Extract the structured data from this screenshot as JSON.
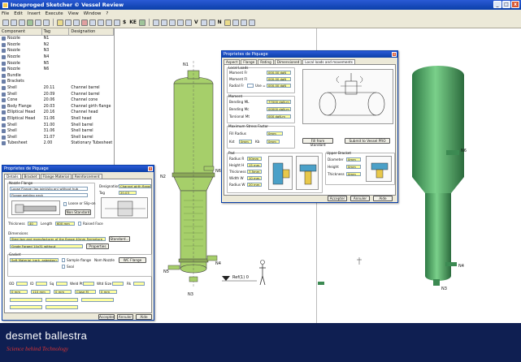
{
  "window": {
    "title": "Inceproged Sketcher © Vessel Review"
  },
  "menu": [
    "File",
    "Edit",
    "Insert",
    "Execute",
    "View",
    "Window",
    "?"
  ],
  "toolbar": {
    "items_text": [
      "$",
      "KE",
      "V",
      "N"
    ]
  },
  "tree": {
    "headers": [
      "Component",
      "Tag",
      "Designation"
    ],
    "rows": [
      {
        "c": "Nozzle",
        "t": "N1",
        "d": ""
      },
      {
        "c": "Nozzle",
        "t": "N2",
        "d": ""
      },
      {
        "c": "Nozzle",
        "t": "N3",
        "d": ""
      },
      {
        "c": "Nozzle",
        "t": "N4",
        "d": ""
      },
      {
        "c": "Nozzle",
        "t": "N5",
        "d": ""
      },
      {
        "c": "Nozzle",
        "t": "N6",
        "d": ""
      },
      {
        "c": "Bundle",
        "t": "",
        "d": ""
      },
      {
        "c": "Brackets",
        "t": "",
        "d": ""
      },
      {
        "c": "Shell",
        "t": "20.11",
        "d": "Channel barrel"
      },
      {
        "c": "Shell",
        "t": "20.09",
        "d": "Channel barrel"
      },
      {
        "c": "Cone",
        "t": "20.06",
        "d": "Channel cone"
      },
      {
        "c": "Body Flange",
        "t": "20.03",
        "d": "Channel girth flange"
      },
      {
        "c": "Elliptical Head",
        "t": "20.16",
        "d": "Channel head"
      },
      {
        "c": "Elliptical Head",
        "t": "31.06",
        "d": "Shell head"
      },
      {
        "c": "Shell",
        "t": "31.00",
        "d": "Shell barrel"
      },
      {
        "c": "Shell",
        "t": "31.06",
        "d": "Shell barrel"
      },
      {
        "c": "Shell",
        "t": "31.07",
        "d": "Shell barrel"
      },
      {
        "c": "Tubesheet",
        "t": "2.00",
        "d": "Stationary Tubesheet"
      }
    ]
  },
  "view": {
    "labels": [
      "N1",
      "N6",
      "N2",
      "N4",
      "N5",
      "N3",
      "Ref(1) 0",
      "N6",
      "N4",
      "N3"
    ]
  },
  "dialog_right": {
    "title": "Proprietes de Piquage",
    "tabs": [
      "Aspect",
      "Flange",
      "Rating",
      "Dimensioned",
      "Local loads and movements"
    ],
    "group_loads": "Local Loads",
    "loads": [
      {
        "label": "Moment Fr",
        "value": "000.00 daN"
      },
      {
        "label": "Moment Fl",
        "value": "000.00 daN"
      },
      {
        "label": "Radial Fr",
        "value": "000.00 daN"
      }
    ],
    "use_label": "Use = 1",
    "group_moments": "Moment",
    "moments": [
      {
        "label": "Bending ML",
        "value": "77000 daN.m"
      },
      {
        "label": "Bending Mc",
        "value": "00000 daN.m"
      },
      {
        "label": "Torsional Mt",
        "value": "000 daN.m"
      }
    ],
    "group_nozzle": "Maximum Stress Factor",
    "nozzle_label": "Fill Radius",
    "nozzle_value": "0mm",
    "row_labels": [
      "Kst",
      "Kb"
    ],
    "row_values": [
      "0mm",
      "0mm"
    ],
    "btn_std": "Fill from Standard",
    "btn_submit": "Submit to Vessel PRO",
    "group_pad": "Pad",
    "pad_labels": [
      "Radius R",
      "Height H",
      "Thickness",
      "Width W",
      "Radius W"
    ],
    "pad_values": [
      "50mm",
      "15 mm",
      "7.5mm",
      "10 mm",
      "20 mm"
    ],
    "group_upper": "Upper Bracket",
    "upper_labels": [
      "Diameter",
      "Height",
      "Thickness"
    ],
    "upper_values": [
      "0mm",
      "0mm",
      "0mm"
    ],
    "buttons": [
      "Accepter",
      "Annuler",
      "Aide"
    ]
  },
  "dialog_left": {
    "title": "Proprietes de Piquage",
    "tabs": [
      "Details",
      "Bracket",
      "Flange Material",
      "Reinforcement"
    ],
    "group_flange": "Nozzle Flange",
    "flange_opts": [
      "Loose Flange (lap joint/slip on) without hub",
      "Flange welding neck",
      "Loose or Slip-on",
      "Non Standard"
    ],
    "designation_label": "Designation",
    "designation_value": "Channel girth flange",
    "tag_label": "Tag",
    "tag_value": "20.03",
    "thickness_label": "Thickness",
    "thickness_value": "40",
    "length_label": "Length",
    "length_value": "600 mm",
    "face_label": "Raised Face",
    "dimensions_label": "Dimensions",
    "flange_std": "Steel bar and manufacturer of the flange 40mm Fermeture",
    "std_btn": "Standard...",
    "material": "Grade Forged 14x31 without",
    "btn_prop": "Properties",
    "group_gasket": "Gasket",
    "gasket_opts": [
      "Soft Material (cork, asbestos)",
      "Sample flange",
      "Seal"
    ],
    "nozzle_label": "Nom Nozzle",
    "nozzle_btn": "WC Flange",
    "row1": [
      "OD",
      "ID",
      "Sq",
      "Weld Pt",
      "Wtd Size",
      "Rk"
    ],
    "row2_vals": [
      "0 mm",
      "110 mm",
      "0 mm",
      "Close M",
      "0 mm"
    ],
    "buttons": [
      "Accepter",
      "Annuler",
      "Aide"
    ]
  },
  "banner": {
    "brand": "desmet ballestra",
    "tagline": "Science behind Technology"
  },
  "colors": {
    "vessel": "#a6cf6a",
    "vessel3d": "#58b56f",
    "banner": "#0f1f52",
    "accent": "#d33333"
  }
}
